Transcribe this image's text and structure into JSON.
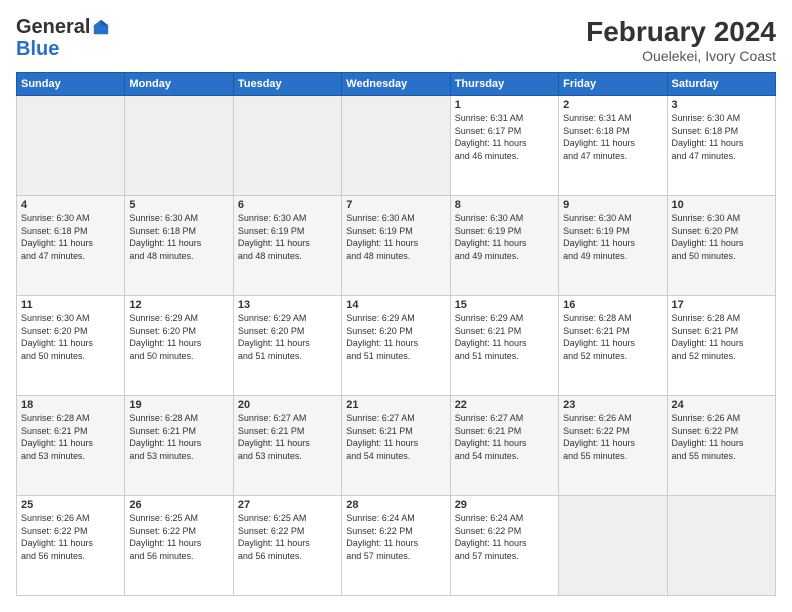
{
  "header": {
    "logo_general": "General",
    "logo_blue": "Blue",
    "month_year": "February 2024",
    "location": "Ouelekei, Ivory Coast"
  },
  "weekdays": [
    "Sunday",
    "Monday",
    "Tuesday",
    "Wednesday",
    "Thursday",
    "Friday",
    "Saturday"
  ],
  "weeks": [
    [
      {
        "day": "",
        "info": ""
      },
      {
        "day": "",
        "info": ""
      },
      {
        "day": "",
        "info": ""
      },
      {
        "day": "",
        "info": ""
      },
      {
        "day": "1",
        "info": "Sunrise: 6:31 AM\nSunset: 6:17 PM\nDaylight: 11 hours\nand 46 minutes."
      },
      {
        "day": "2",
        "info": "Sunrise: 6:31 AM\nSunset: 6:18 PM\nDaylight: 11 hours\nand 47 minutes."
      },
      {
        "day": "3",
        "info": "Sunrise: 6:30 AM\nSunset: 6:18 PM\nDaylight: 11 hours\nand 47 minutes."
      }
    ],
    [
      {
        "day": "4",
        "info": "Sunrise: 6:30 AM\nSunset: 6:18 PM\nDaylight: 11 hours\nand 47 minutes."
      },
      {
        "day": "5",
        "info": "Sunrise: 6:30 AM\nSunset: 6:18 PM\nDaylight: 11 hours\nand 48 minutes."
      },
      {
        "day": "6",
        "info": "Sunrise: 6:30 AM\nSunset: 6:19 PM\nDaylight: 11 hours\nand 48 minutes."
      },
      {
        "day": "7",
        "info": "Sunrise: 6:30 AM\nSunset: 6:19 PM\nDaylight: 11 hours\nand 48 minutes."
      },
      {
        "day": "8",
        "info": "Sunrise: 6:30 AM\nSunset: 6:19 PM\nDaylight: 11 hours\nand 49 minutes."
      },
      {
        "day": "9",
        "info": "Sunrise: 6:30 AM\nSunset: 6:19 PM\nDaylight: 11 hours\nand 49 minutes."
      },
      {
        "day": "10",
        "info": "Sunrise: 6:30 AM\nSunset: 6:20 PM\nDaylight: 11 hours\nand 50 minutes."
      }
    ],
    [
      {
        "day": "11",
        "info": "Sunrise: 6:30 AM\nSunset: 6:20 PM\nDaylight: 11 hours\nand 50 minutes."
      },
      {
        "day": "12",
        "info": "Sunrise: 6:29 AM\nSunset: 6:20 PM\nDaylight: 11 hours\nand 50 minutes."
      },
      {
        "day": "13",
        "info": "Sunrise: 6:29 AM\nSunset: 6:20 PM\nDaylight: 11 hours\nand 51 minutes."
      },
      {
        "day": "14",
        "info": "Sunrise: 6:29 AM\nSunset: 6:20 PM\nDaylight: 11 hours\nand 51 minutes."
      },
      {
        "day": "15",
        "info": "Sunrise: 6:29 AM\nSunset: 6:21 PM\nDaylight: 11 hours\nand 51 minutes."
      },
      {
        "day": "16",
        "info": "Sunrise: 6:28 AM\nSunset: 6:21 PM\nDaylight: 11 hours\nand 52 minutes."
      },
      {
        "day": "17",
        "info": "Sunrise: 6:28 AM\nSunset: 6:21 PM\nDaylight: 11 hours\nand 52 minutes."
      }
    ],
    [
      {
        "day": "18",
        "info": "Sunrise: 6:28 AM\nSunset: 6:21 PM\nDaylight: 11 hours\nand 53 minutes."
      },
      {
        "day": "19",
        "info": "Sunrise: 6:28 AM\nSunset: 6:21 PM\nDaylight: 11 hours\nand 53 minutes."
      },
      {
        "day": "20",
        "info": "Sunrise: 6:27 AM\nSunset: 6:21 PM\nDaylight: 11 hours\nand 53 minutes."
      },
      {
        "day": "21",
        "info": "Sunrise: 6:27 AM\nSunset: 6:21 PM\nDaylight: 11 hours\nand 54 minutes."
      },
      {
        "day": "22",
        "info": "Sunrise: 6:27 AM\nSunset: 6:21 PM\nDaylight: 11 hours\nand 54 minutes."
      },
      {
        "day": "23",
        "info": "Sunrise: 6:26 AM\nSunset: 6:22 PM\nDaylight: 11 hours\nand 55 minutes."
      },
      {
        "day": "24",
        "info": "Sunrise: 6:26 AM\nSunset: 6:22 PM\nDaylight: 11 hours\nand 55 minutes."
      }
    ],
    [
      {
        "day": "25",
        "info": "Sunrise: 6:26 AM\nSunset: 6:22 PM\nDaylight: 11 hours\nand 56 minutes."
      },
      {
        "day": "26",
        "info": "Sunrise: 6:25 AM\nSunset: 6:22 PM\nDaylight: 11 hours\nand 56 minutes."
      },
      {
        "day": "27",
        "info": "Sunrise: 6:25 AM\nSunset: 6:22 PM\nDaylight: 11 hours\nand 56 minutes."
      },
      {
        "day": "28",
        "info": "Sunrise: 6:24 AM\nSunset: 6:22 PM\nDaylight: 11 hours\nand 57 minutes."
      },
      {
        "day": "29",
        "info": "Sunrise: 6:24 AM\nSunset: 6:22 PM\nDaylight: 11 hours\nand 57 minutes."
      },
      {
        "day": "",
        "info": ""
      },
      {
        "day": "",
        "info": ""
      }
    ]
  ]
}
